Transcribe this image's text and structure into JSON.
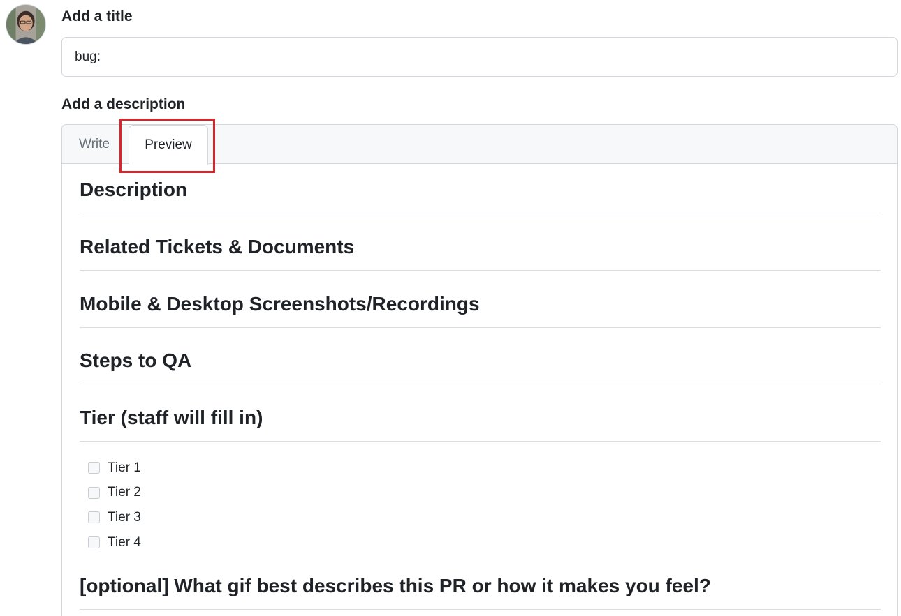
{
  "title_section": {
    "label": "Add a title",
    "input_value": "bug:"
  },
  "description_section": {
    "label": "Add a description",
    "tabs": [
      {
        "label": "Write"
      },
      {
        "label": "Preview"
      }
    ],
    "active_tab": "Preview",
    "preview": {
      "headings": [
        "Description",
        "Related Tickets & Documents",
        "Mobile & Desktop Screenshots/Recordings",
        "Steps to QA",
        "Tier (staff will fill in)"
      ],
      "tier_items": [
        "Tier 1",
        "Tier 2",
        "Tier 3",
        "Tier 4"
      ],
      "last_heading": "[optional] What gif best describes this PR or how it makes you feel?"
    }
  },
  "colors": {
    "highlight": "#d9262b",
    "border": "#d0d7de",
    "tab_bar_bg": "#f6f8fa"
  }
}
